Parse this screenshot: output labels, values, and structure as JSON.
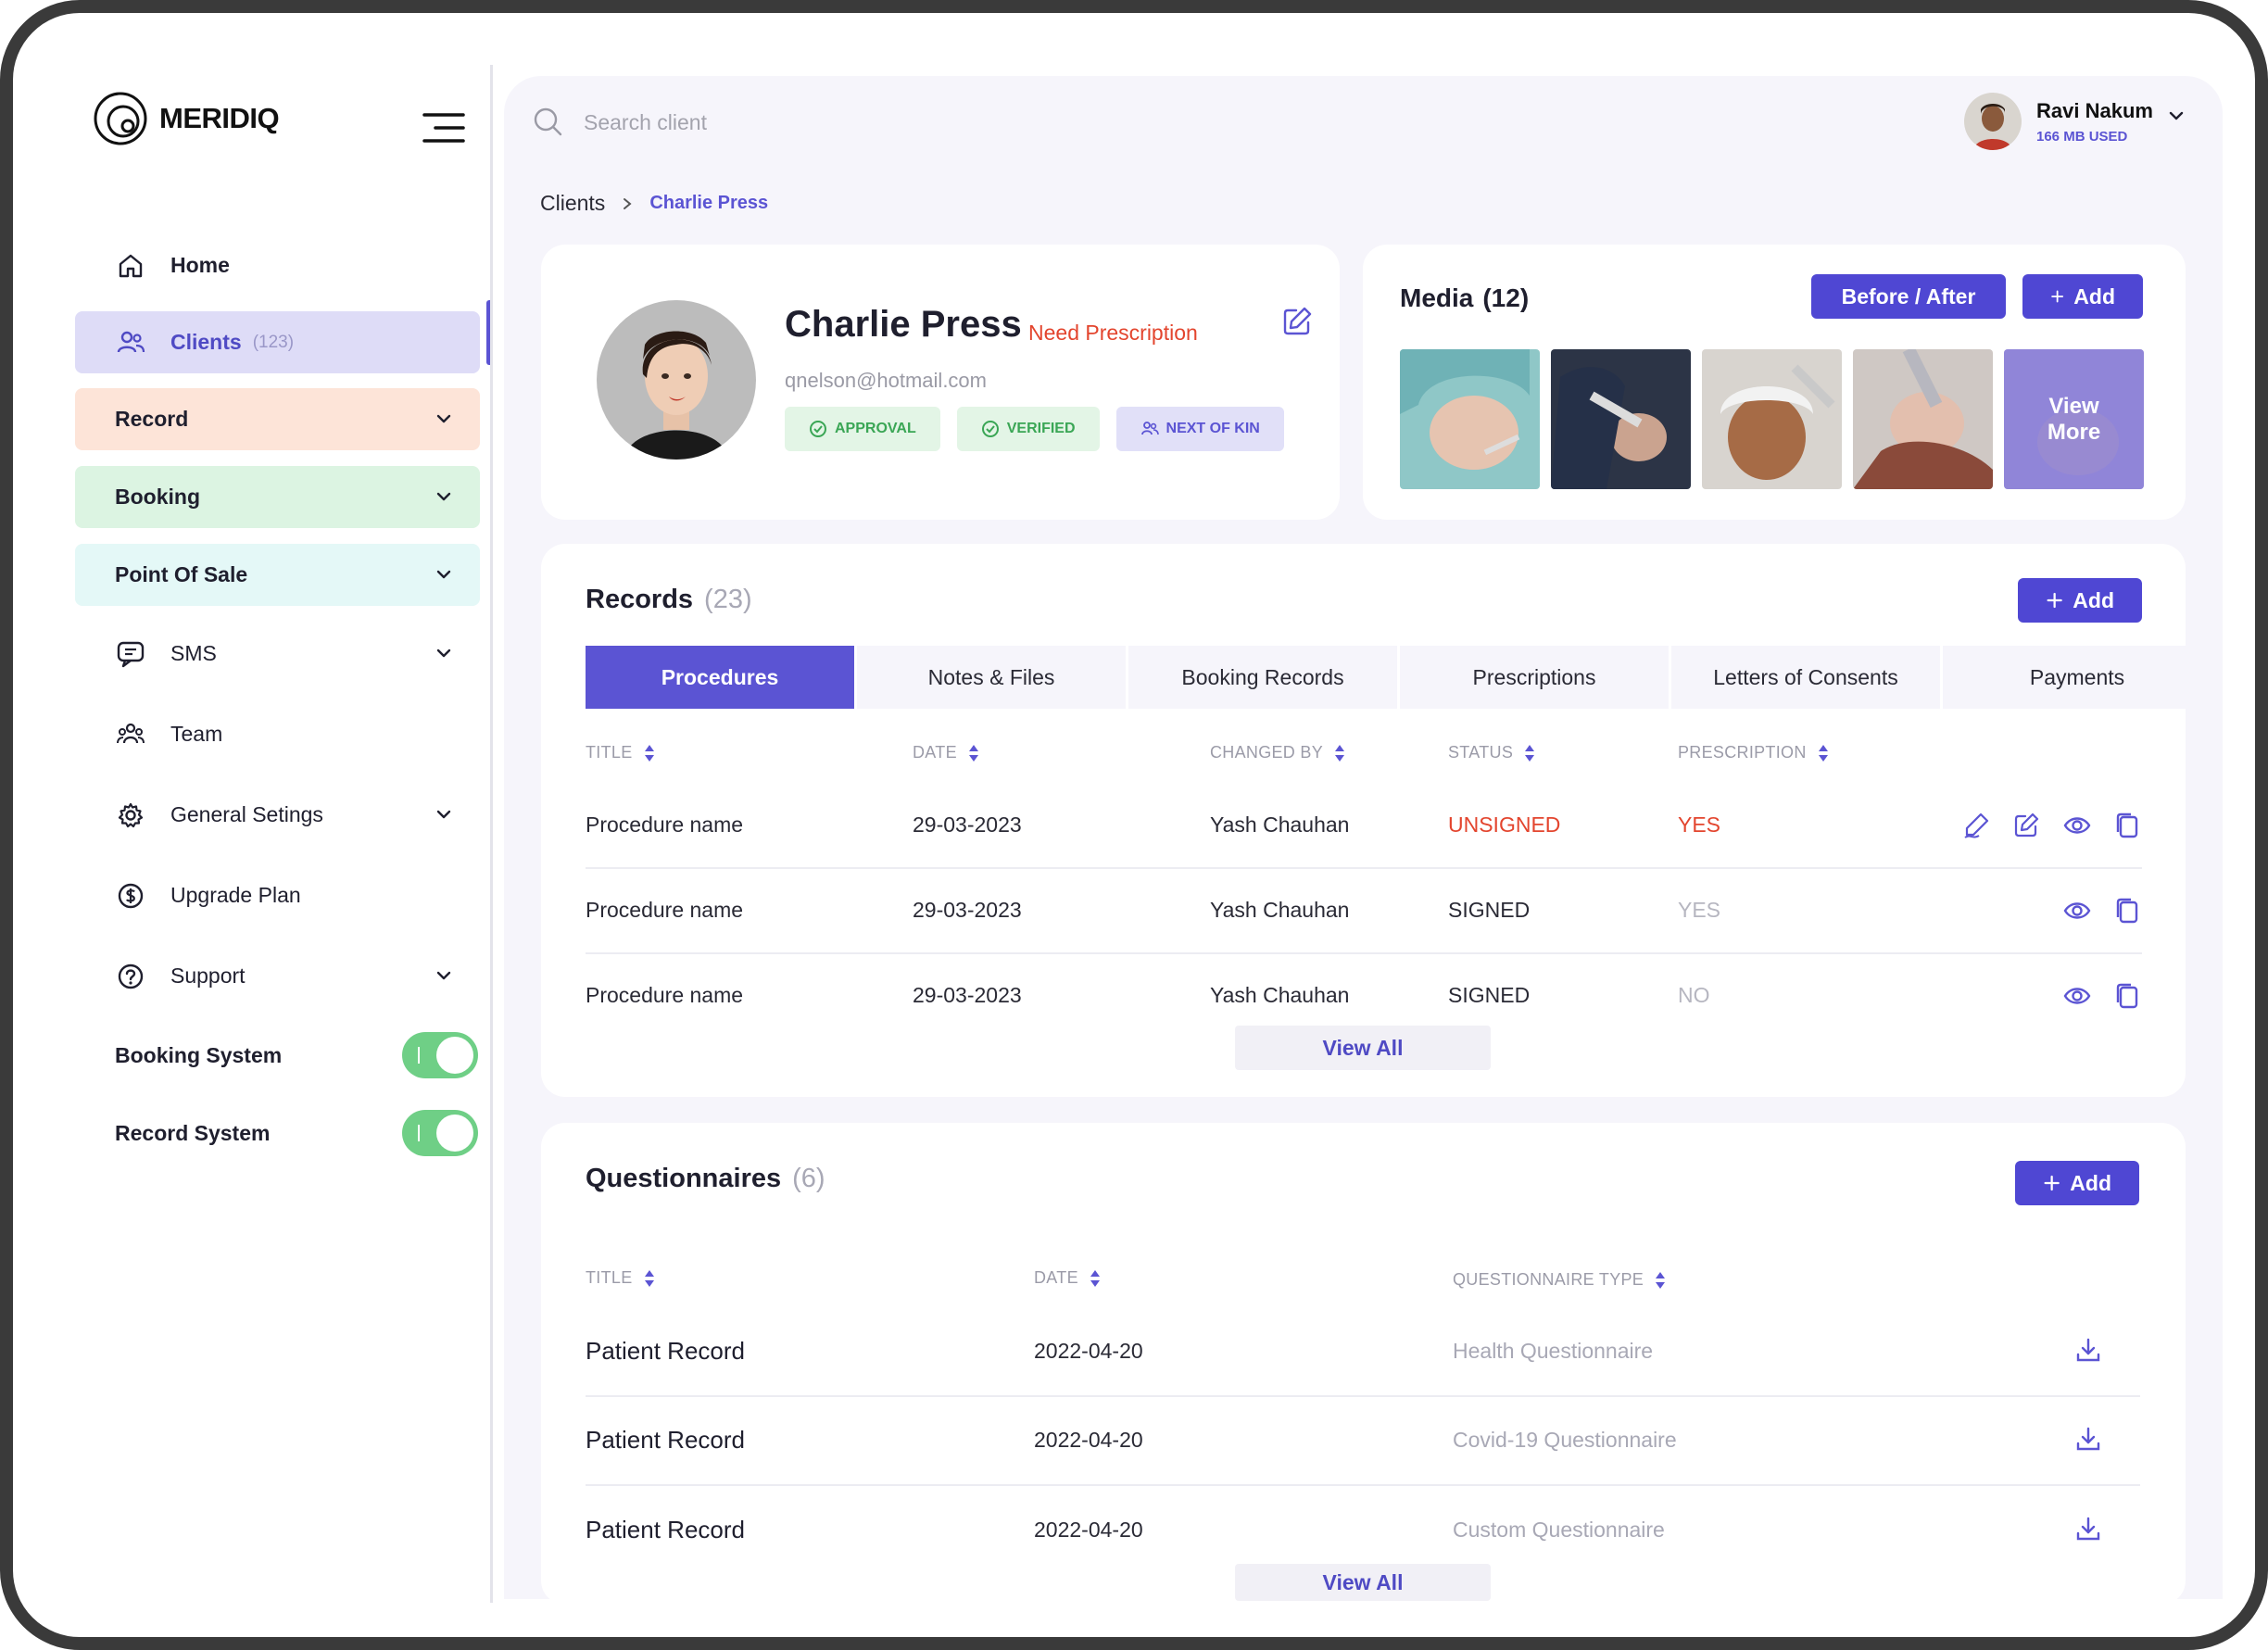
{
  "app": {
    "logo_text": "MERIDIQ"
  },
  "sidebar": {
    "home": "Home",
    "clients": "Clients",
    "clients_count": "(123)",
    "record": "Record",
    "booking": "Booking",
    "pos": "Point Of Sale",
    "sms": "SMS",
    "team": "Team",
    "general": "General Setings",
    "upgrade": "Upgrade Plan",
    "support": "Support",
    "booking_system": "Booking System",
    "record_system": "Record System"
  },
  "search": {
    "placeholder": "Search client"
  },
  "user": {
    "name": "Ravi Nakum",
    "usage": "166 MB USED"
  },
  "breadcrumb": {
    "root": "Clients",
    "current": "Charlie Press"
  },
  "profile": {
    "name": "Charlie Press",
    "tag": "Need Prescription",
    "email": "qnelson@hotmail.com",
    "badges": {
      "approval": "APPROVAL",
      "verified": "VERIFIED",
      "kin": "NEXT OF KIN"
    }
  },
  "media": {
    "title": "Media",
    "count": "(12)",
    "before_after": "Before / After",
    "add": "Add",
    "view_more_1": "View",
    "view_more_2": "More"
  },
  "records": {
    "title": "Records",
    "count": "(23)",
    "add": "Add",
    "tabs": [
      "Procedures",
      "Notes & Files",
      "Booking Records",
      "Prescriptions",
      "Letters of Consents",
      "Payments"
    ],
    "columns": [
      "TITLE",
      "DATE",
      "CHANGED BY",
      "STATUS",
      "PRESCRIPTION"
    ],
    "rows": [
      {
        "title": "Procedure name",
        "date": "29-03-2023",
        "by": "Yash Chauhan",
        "status": "UNSIGNED",
        "prescription": "YES"
      },
      {
        "title": "Procedure name",
        "date": "29-03-2023",
        "by": "Yash Chauhan",
        "status": "SIGNED",
        "prescription": "YES"
      },
      {
        "title": "Procedure name",
        "date": "29-03-2023",
        "by": "Yash Chauhan",
        "status": "SIGNED",
        "prescription": "NO"
      }
    ],
    "view_all": "View All"
  },
  "questionnaires": {
    "title": "Questionnaires",
    "count": "(6)",
    "add": "Add",
    "columns": [
      "TITLE",
      "DATE",
      "QUESTIONNAIRE TYPE"
    ],
    "rows": [
      {
        "title": "Patient Record",
        "date": "2022-04-20",
        "type": "Health Questionnaire"
      },
      {
        "title": "Patient Record",
        "date": "2022-04-20",
        "type": "Covid-19 Questionnaire"
      },
      {
        "title": "Patient Record",
        "date": "2022-04-20",
        "type": "Custom Questionnaire"
      }
    ],
    "view_all": "View All"
  },
  "colors": {
    "accent": "#5b54d3",
    "danger": "#e3452e",
    "success": "#3aa655",
    "toggle_on": "#6fcf86"
  },
  "icons": {
    "logo": "circle-logo-icon",
    "menu": "hamburger-icon",
    "search": "search-icon",
    "row_actions": [
      "sign-icon",
      "edit-icon",
      "eye-icon",
      "copy-icon"
    ],
    "download": "download-icon"
  }
}
